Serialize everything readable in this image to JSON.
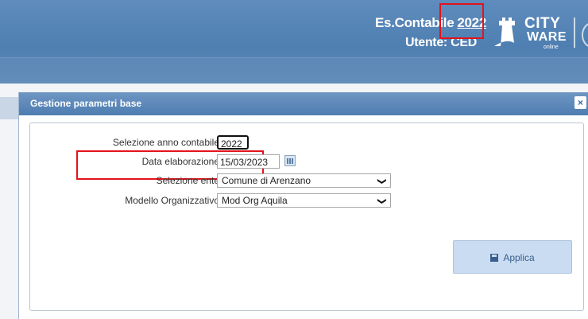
{
  "header": {
    "es_label": "Es.Contabile",
    "es_year": "2022",
    "user_line": "Utente: CED",
    "logo": {
      "line1": "CITY",
      "line2": "WARE",
      "line3": "online"
    }
  },
  "dialog": {
    "title": "Gestione parametri base",
    "close_label": "×",
    "fields": {
      "anno_label": "Selezione anno contabile",
      "anno_value": "2022",
      "data_label": "Data elaborazione",
      "data_value": "15/03/2023",
      "ente_label": "Selezione ente",
      "ente_value": "Comune di Arenzano",
      "modello_label": "Modello Organizzativo",
      "modello_value": "Mod Org Aquila"
    },
    "apply_label": "Applica"
  },
  "colors": {
    "header": "#4f7fb1",
    "highlight": "#e3131b",
    "button": "#c9dcf1"
  },
  "icons": [
    "calendar-icon",
    "chevron-down-icon",
    "save-icon",
    "close-icon",
    "cityware-tower-icon"
  ]
}
